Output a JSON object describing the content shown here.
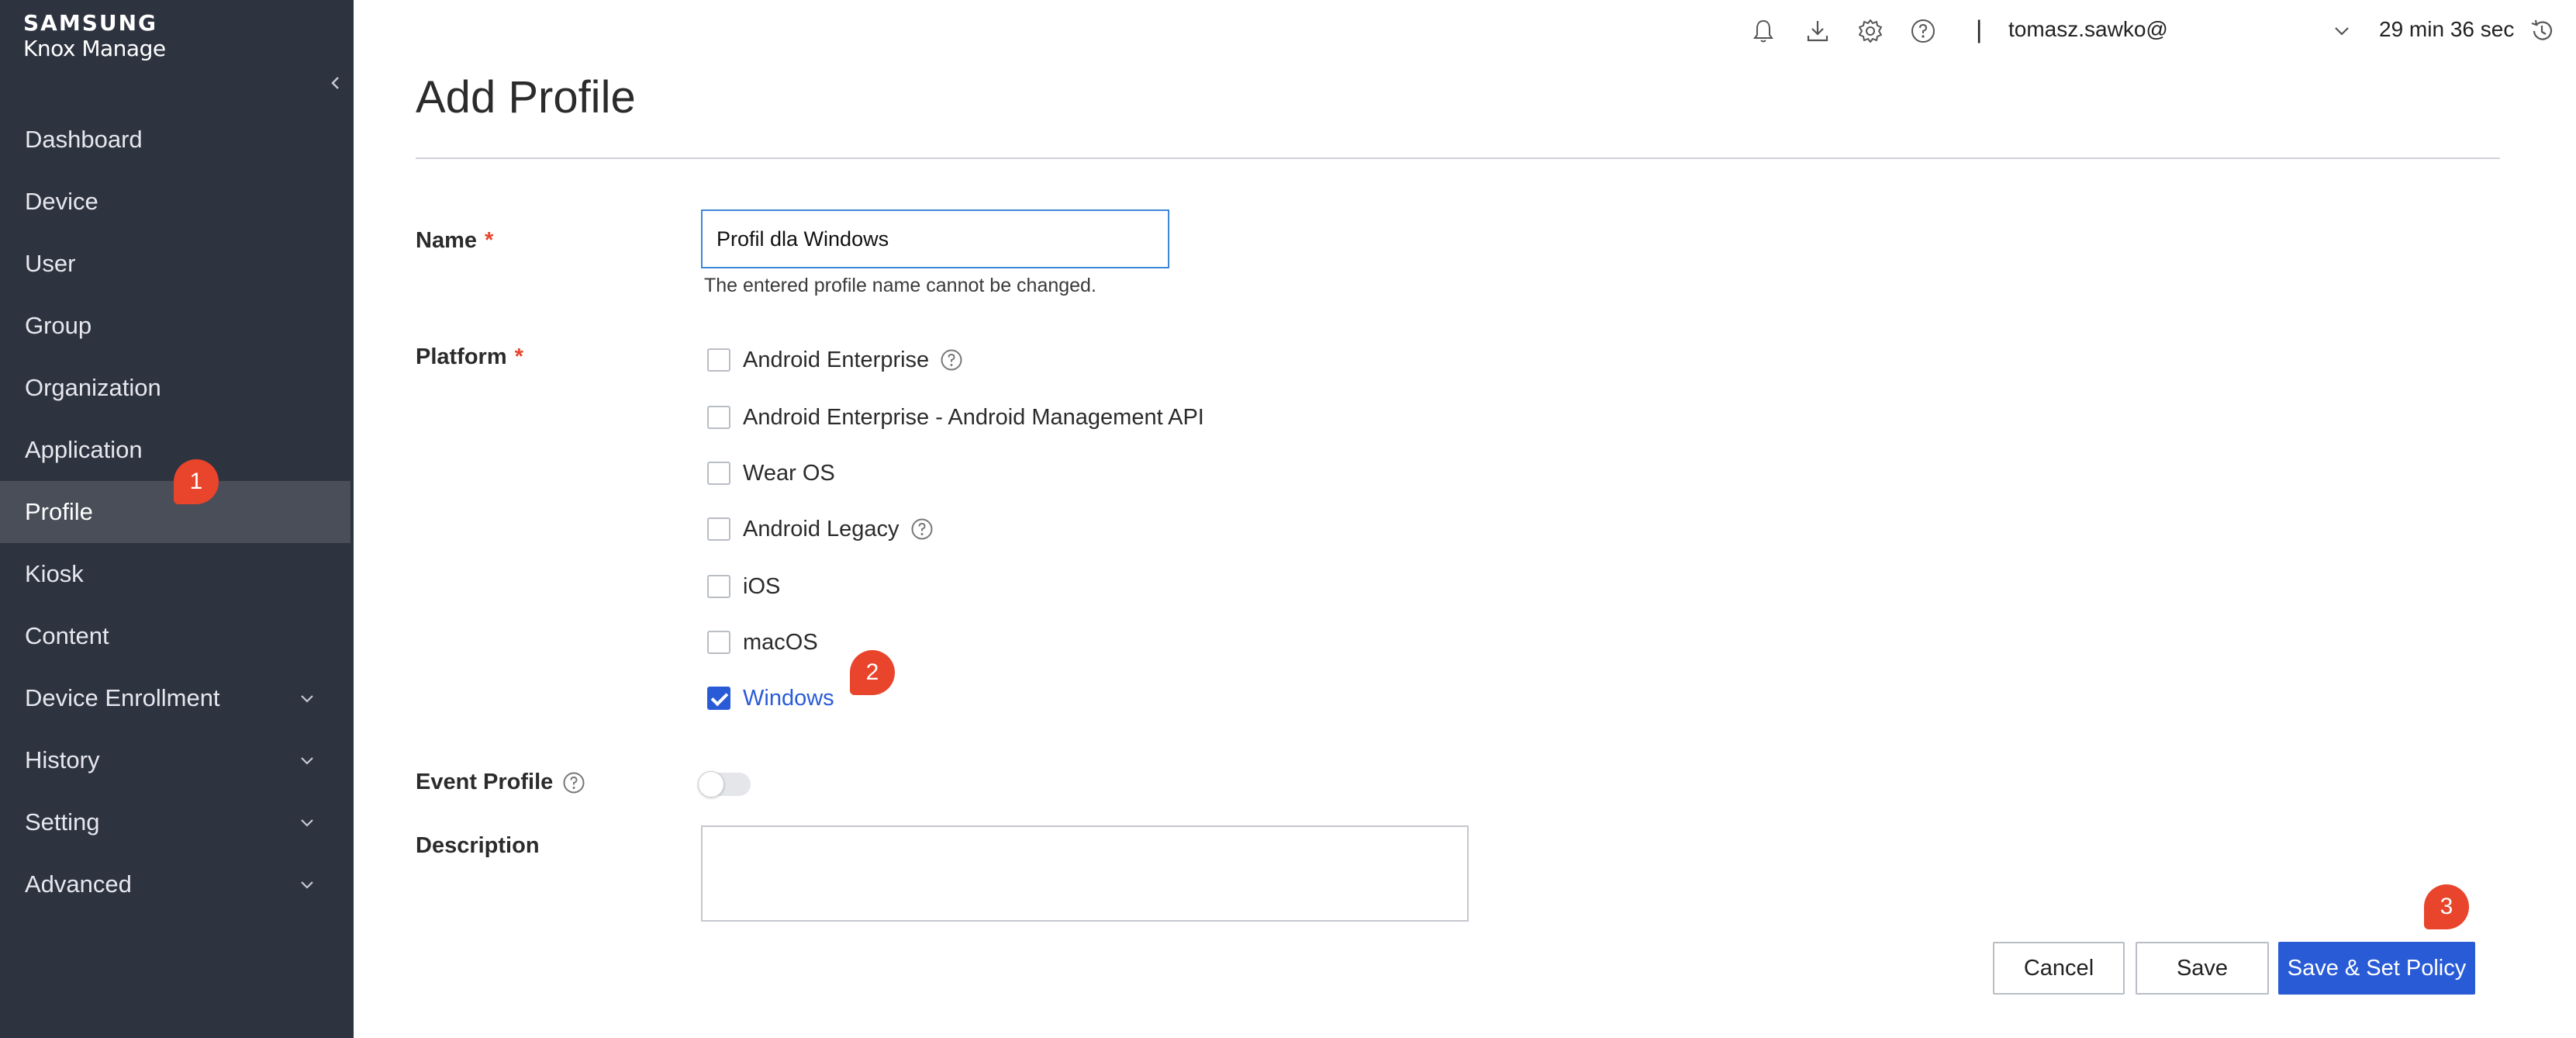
{
  "brand": {
    "line1": "SAMSUNG",
    "line2": "Knox Manage"
  },
  "sidebar": {
    "items": [
      {
        "label": "Dashboard"
      },
      {
        "label": "Device"
      },
      {
        "label": "User"
      },
      {
        "label": "Group"
      },
      {
        "label": "Organization"
      },
      {
        "label": "Application"
      },
      {
        "label": "Profile",
        "active": true
      },
      {
        "label": "Kiosk"
      },
      {
        "label": "Content"
      },
      {
        "label": "Device Enrollment",
        "expandable": true
      },
      {
        "label": "History",
        "expandable": true
      },
      {
        "label": "Setting",
        "expandable": true
      },
      {
        "label": "Advanced",
        "expandable": true
      }
    ]
  },
  "topbar": {
    "icons": [
      "bell-icon",
      "download-icon",
      "gear-icon",
      "help-icon"
    ],
    "separator": "|",
    "username": "tomasz.sawko@",
    "session_time": "29 min 36 sec"
  },
  "page": {
    "title": "Add Profile"
  },
  "form": {
    "name_label": "Name",
    "required_mark": "*",
    "name_value": "Profil dla Windows",
    "name_hint": "The entered profile name cannot be changed.",
    "platform_label": "Platform",
    "platforms": [
      {
        "label": "Android Enterprise",
        "checked": false,
        "help": true
      },
      {
        "label": "Android Enterprise - Android Management API",
        "checked": false
      },
      {
        "label": "Wear OS",
        "checked": false
      },
      {
        "label": "Android Legacy",
        "checked": false,
        "help": true
      },
      {
        "label": "iOS",
        "checked": false
      },
      {
        "label": "macOS",
        "checked": false
      },
      {
        "label": "Windows",
        "checked": true
      }
    ],
    "event_profile_label": "Event Profile",
    "event_profile_enabled": false,
    "description_label": "Description",
    "description_value": ""
  },
  "buttons": {
    "cancel": "Cancel",
    "save": "Save",
    "save_set_policy": "Save & Set Policy"
  },
  "annotations": {
    "step1": "1",
    "step2": "2",
    "step3": "3"
  },
  "colors": {
    "sidebar_bg": "#2e3340",
    "accent": "#2a5bd7",
    "badge": "#e8452c"
  }
}
